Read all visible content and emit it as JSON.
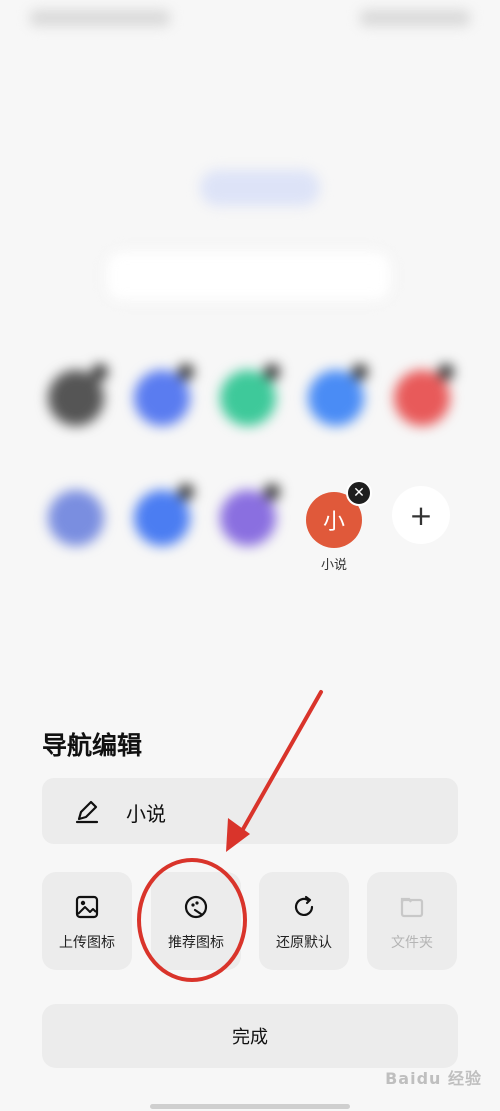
{
  "grid": {
    "novel": {
      "icon_char": "小",
      "label": "小说",
      "close_icon": "close-icon"
    },
    "add": {
      "symbol": "+"
    }
  },
  "sheet": {
    "title": "导航编辑",
    "name_value": "小说",
    "actions": [
      {
        "label": "上传图标",
        "icon": "image-icon",
        "enabled": true
      },
      {
        "label": "推荐图标",
        "icon": "recommend-icon",
        "enabled": true
      },
      {
        "label": "还原默认",
        "icon": "refresh-icon",
        "enabled": true
      },
      {
        "label": "文件夹",
        "icon": "folder-icon",
        "enabled": false
      }
    ],
    "done_label": "完成"
  },
  "watermark": {
    "text": "Baidu 经验"
  },
  "colors": {
    "annotation_red": "#d9342b",
    "novel_icon_bg": "#e0593a"
  }
}
